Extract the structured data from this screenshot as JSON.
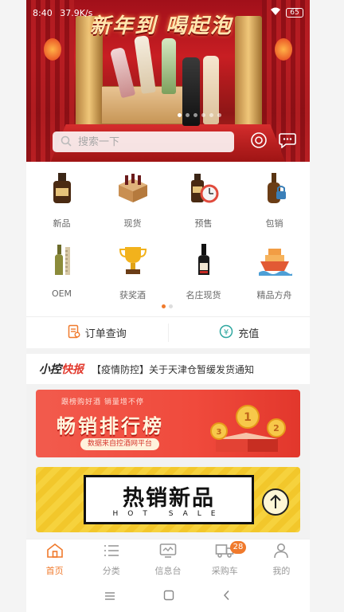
{
  "status_bar": {
    "time": "8:40",
    "speed": "37.9K/s",
    "battery": "65"
  },
  "hero": {
    "title": "新年到 喝起泡",
    "slides": 6,
    "active_slide": 0
  },
  "search": {
    "placeholder": "搜索一下"
  },
  "categories": [
    {
      "label": "新品",
      "icon": "new-wine-icon"
    },
    {
      "label": "现货",
      "icon": "wine-crate-icon"
    },
    {
      "label": "预售",
      "icon": "presale-clock-icon"
    },
    {
      "label": "包销",
      "icon": "lock-bottle-icon"
    },
    {
      "label": "OEM",
      "icon": "oem-bottle-icon"
    },
    {
      "label": "获奖酒",
      "icon": "trophy-icon"
    },
    {
      "label": "名庄现货",
      "icon": "estate-bottle-icon"
    },
    {
      "label": "精品方舟",
      "icon": "ship-icon"
    }
  ],
  "actions": {
    "order_query": "订单查询",
    "recharge": "充值"
  },
  "news": {
    "brand_a": "小控",
    "brand_b": "快报",
    "headline": "【疫情防控】关于天津仓暂缓发货通知"
  },
  "banner_rank": {
    "tag": "跟榜购好酒 销量增不停",
    "title": "畅销排行榜",
    "pill": "数据来自控酒网平台"
  },
  "banner_hot": {
    "title": "热销新品",
    "subtitle": "HOT SALE"
  },
  "tabbar": [
    {
      "label": "首页",
      "icon": "home-icon",
      "active": true
    },
    {
      "label": "分类",
      "icon": "list-icon",
      "active": false
    },
    {
      "label": "信息台",
      "icon": "monitor-icon",
      "active": false
    },
    {
      "label": "采购车",
      "icon": "truck-icon",
      "active": false,
      "badge": "28"
    },
    {
      "label": "我的",
      "icon": "user-icon",
      "active": false
    }
  ],
  "colors": {
    "accent": "#f07a2c",
    "hero_red": "#c81e23"
  }
}
